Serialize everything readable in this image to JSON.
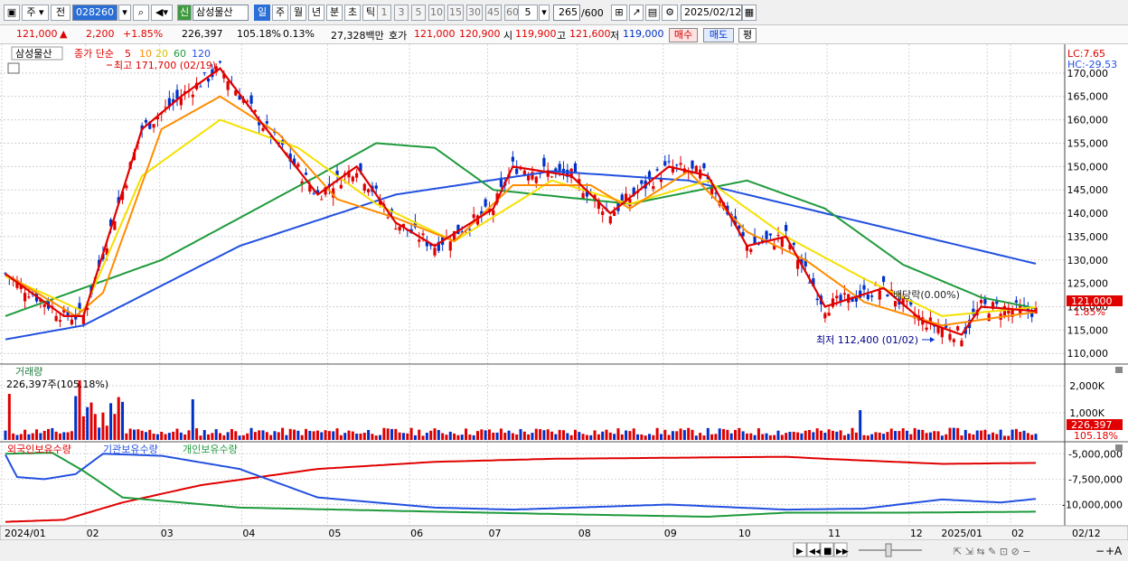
{
  "toolbar": {
    "period": "주",
    "market": "전",
    "code": "028260",
    "stock_name": "삼성물산",
    "credit_badge": "신",
    "periods": [
      "일",
      "주",
      "월",
      "년",
      "분",
      "초",
      "틱"
    ],
    "selected_period": "일",
    "intervals": [
      "1",
      "3",
      "5",
      "10",
      "15",
      "30",
      "45",
      "60"
    ],
    "tick_count": "5",
    "range": "265",
    "range_max": "/600",
    "date": "2025/02/12"
  },
  "quote": {
    "price": "121,000",
    "change_arrow": "▲",
    "change": "2,200",
    "change_pct": "+1.85%",
    "volume": "226,397",
    "volume_ratio": "105.18%",
    "turnover": "0.13%",
    "amount": "27,328백만",
    "ask_label": "호가",
    "ask": "121,000",
    "bid": "120,900",
    "open_label": "시",
    "open": "119,900",
    "high_label": "고",
    "high": "121,600",
    "low_label": "저",
    "low": "119,000",
    "buy_label": "매수",
    "sell_label": "매도",
    "eval_label": "평"
  },
  "price_panel": {
    "title": "삼성물산",
    "legend_prefix": "종가 단순",
    "ma_periods": [
      "5",
      "10",
      "20",
      "60",
      "120"
    ],
    "ma_colors": [
      "#e00000",
      "#ff8c00",
      "#f5e000",
      "#1e9a3c",
      "#2250e0"
    ],
    "high_annotation": "최고 171,700 (02/19)",
    "low_annotation": "최저 112,400 (01/02)",
    "dividend_annotation": "배당락(0.00%)",
    "lc": "LC:7.65",
    "hc": "HC:-29.53",
    "current_tag": "121,000",
    "current_pct": "1.85%"
  },
  "volume_panel": {
    "title": "거래량",
    "subtitle": "226,397주(105.18%)",
    "current_tag": "226,397",
    "current_pct": "105.18%"
  },
  "holder_panel": {
    "legend": [
      "외국인보유수량",
      "기관보유수량",
      "개인보유수량"
    ]
  },
  "x_axis": {
    "labels": [
      "2024/01",
      "02",
      "03",
      "04",
      "05",
      "06",
      "07",
      "08",
      "09",
      "10",
      "11",
      "12",
      "2025/01",
      "02"
    ],
    "right_label": "02/12"
  },
  "chart_data": [
    {
      "type": "line",
      "title": "삼성물산",
      "x_tick_labels": [
        "2024/01",
        "02",
        "03",
        "04",
        "05",
        "06",
        "07",
        "08",
        "09",
        "10",
        "11",
        "12",
        "2025/01",
        "02"
      ],
      "y_ticks": [
        110000,
        115000,
        120000,
        125000,
        130000,
        135000,
        140000,
        145000,
        150000,
        155000,
        160000,
        165000,
        170000
      ],
      "ylim": [
        108500,
        175000
      ],
      "series_anchor_points": [
        {
          "name": "5",
          "values": [
            [
              0,
              127000
            ],
            [
              15,
              118000
            ],
            [
              20,
              118000
            ],
            [
              35,
              158000
            ],
            [
              45,
              165000
            ],
            [
              55,
              171000
            ],
            [
              65,
              160000
            ],
            [
              80,
              144000
            ],
            [
              90,
              150000
            ],
            [
              100,
              138000
            ],
            [
              110,
              133000
            ],
            [
              125,
              141000
            ],
            [
              130,
              150000
            ],
            [
              145,
              148000
            ],
            [
              155,
              140000
            ],
            [
              170,
              150000
            ],
            [
              180,
              148000
            ],
            [
              190,
              133000
            ],
            [
              200,
              135000
            ],
            [
              210,
              120000
            ],
            [
              225,
              124000
            ],
            [
              235,
              117000
            ],
            [
              245,
              114000
            ],
            [
              250,
              120000
            ],
            [
              265,
              119000
            ]
          ]
        },
        {
          "name": "10",
          "values": [
            [
              0,
              127000
            ],
            [
              18,
              118000
            ],
            [
              25,
              123000
            ],
            [
              40,
              158000
            ],
            [
              55,
              165000
            ],
            [
              70,
              157000
            ],
            [
              85,
              143000
            ],
            [
              100,
              139000
            ],
            [
              115,
              134000
            ],
            [
              130,
              146000
            ],
            [
              150,
              146000
            ],
            [
              160,
              141000
            ],
            [
              175,
              149000
            ],
            [
              190,
              136000
            ],
            [
              205,
              130000
            ],
            [
              220,
              121000
            ],
            [
              240,
              116000
            ],
            [
              265,
              119000
            ]
          ]
        },
        {
          "name": "20",
          "values": [
            [
              0,
              126500
            ],
            [
              20,
              119000
            ],
            [
              35,
              148000
            ],
            [
              55,
              160000
            ],
            [
              75,
              154000
            ],
            [
              95,
              142000
            ],
            [
              115,
              134000
            ],
            [
              140,
              147000
            ],
            [
              160,
              142000
            ],
            [
              180,
              147000
            ],
            [
              200,
              135000
            ],
            [
              220,
              126000
            ],
            [
              240,
              118000
            ],
            [
              265,
              120000
            ]
          ]
        },
        {
          "name": "60",
          "values": [
            [
              0,
              118000
            ],
            [
              40,
              130000
            ],
            [
              80,
              148000
            ],
            [
              95,
              155000
            ],
            [
              110,
              154000
            ],
            [
              125,
              145000
            ],
            [
              160,
              142000
            ],
            [
              190,
              147000
            ],
            [
              210,
              141000
            ],
            [
              230,
              129000
            ],
            [
              250,
              122000
            ],
            [
              265,
              119500
            ]
          ]
        },
        {
          "name": "120",
          "values": [
            [
              0,
              113000
            ],
            [
              20,
              116000
            ],
            [
              60,
              133000
            ],
            [
              100,
              144000
            ],
            [
              140,
              149000
            ],
            [
              175,
              147000
            ],
            [
              200,
              142000
            ],
            [
              230,
              136000
            ],
            [
              265,
              129000
            ]
          ]
        }
      ]
    },
    {
      "type": "bar",
      "title": "거래량",
      "y_ticks": [
        1000000,
        2000000
      ],
      "y_tick_labels": [
        "1,000K",
        "2,000K"
      ],
      "latest_value": 226397
    },
    {
      "type": "line",
      "series": [
        {
          "name": "외국인보유수량"
        },
        {
          "name": "기관보유수량"
        },
        {
          "name": "개인보유수량"
        }
      ],
      "y_ticks": [
        -5000000,
        -7500000,
        -10000000
      ],
      "y_tick_labels": [
        "-5,000,000",
        "-7,500,000",
        "-10,000,000"
      ]
    }
  ],
  "scrollbar": {
    "buttons": [
      "▶",
      "▶▶",
      "■",
      "▶▶"
    ]
  }
}
